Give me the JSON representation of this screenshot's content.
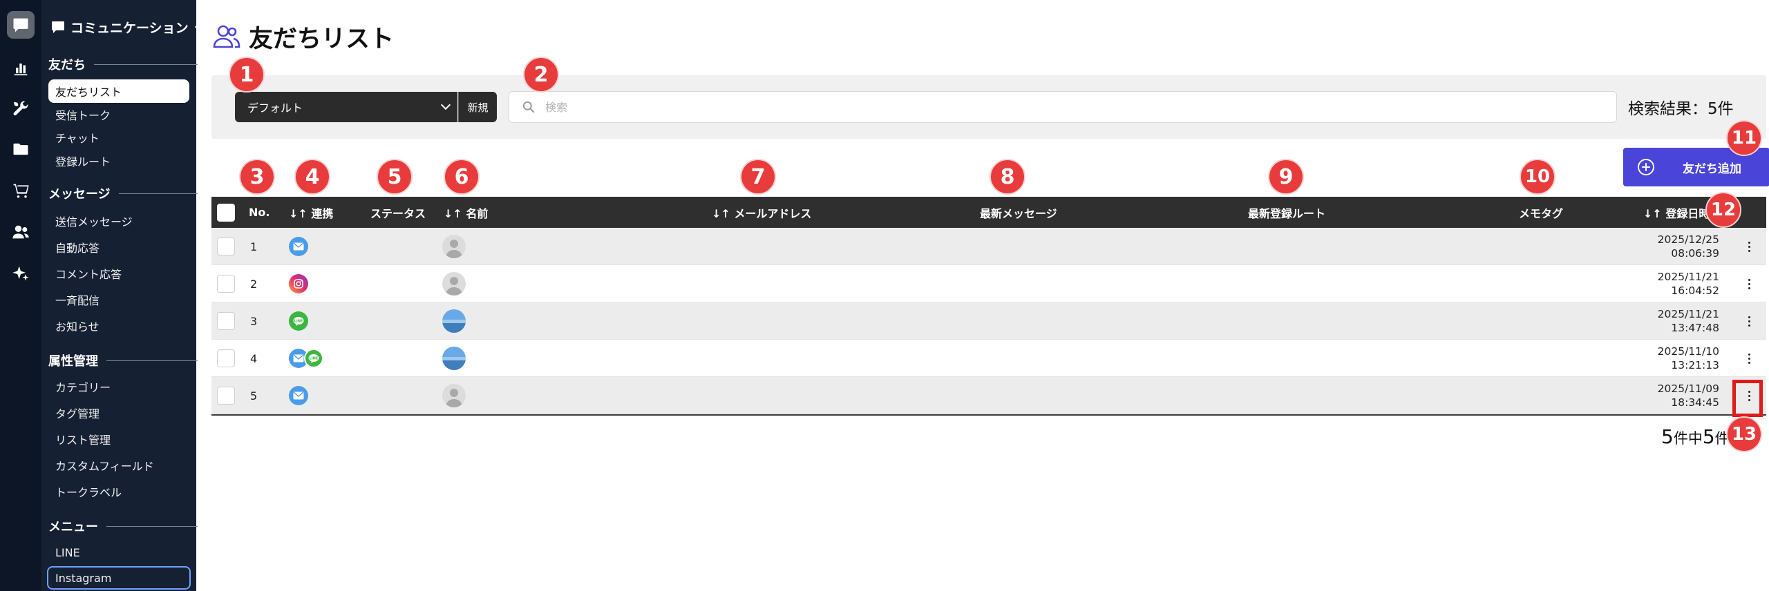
{
  "sidebar": {
    "header": "コミュニケーション",
    "sections": [
      {
        "title": "友だち",
        "items": [
          "友だちリスト",
          "受信トーク",
          "チャット",
          "登録ルート"
        ]
      },
      {
        "title": "メッセージ",
        "items": [
          "送信メッセージ",
          "自動応答",
          "コメント応答",
          "一斉配信",
          "お知らせ"
        ]
      },
      {
        "title": "属性管理",
        "items": [
          "カテゴリー",
          "タグ管理",
          "リスト管理",
          "カスタムフィールド",
          "トークラベル"
        ]
      },
      {
        "title": "メニュー",
        "items": [
          "LINE",
          "Instagram"
        ]
      }
    ],
    "active_item": "友だちリスト",
    "rail_icons": [
      "chat-icon",
      "analytics-icon",
      "tools-icon",
      "folder-icon",
      "cart-icon",
      "users-icon",
      "sparkle-icon"
    ]
  },
  "page": {
    "title": "友だちリスト"
  },
  "filter": {
    "preset_value": "デフォルト",
    "new_label": "新規",
    "search_placeholder": "検索",
    "result_count": "検索結果：5件"
  },
  "add_friend_label": "友だち追加",
  "table": {
    "columns": {
      "no": "No.",
      "channel": "↓↑ 連携",
      "status": "ステータス",
      "name": "↓↑ 名前",
      "email": "↓↑ メールアドレス",
      "latest_message": "最新メッセージ",
      "latest_route": "最新登録ルート",
      "memo_tag": "メモタグ",
      "registered": "↓↑ 登録日時"
    },
    "rows": [
      {
        "no": "1",
        "channels": [
          "mail"
        ],
        "avatar": "default",
        "date": "2025/12/25",
        "time": "08:06:39"
      },
      {
        "no": "2",
        "channels": [
          "instagram"
        ],
        "avatar": "default",
        "date": "2025/11/21",
        "time": "16:04:52"
      },
      {
        "no": "3",
        "channels": [
          "line"
        ],
        "avatar": "photo",
        "date": "2025/11/21",
        "time": "13:47:48"
      },
      {
        "no": "4",
        "channels": [
          "mail",
          "line"
        ],
        "avatar": "photo",
        "date": "2025/11/10",
        "time": "13:21:13"
      },
      {
        "no": "5",
        "channels": [
          "mail"
        ],
        "avatar": "default",
        "date": "2025/11/09",
        "time": "18:34:45"
      }
    ]
  },
  "pagination": {
    "total": "5",
    "unit_a": "件中",
    "shown": "5",
    "unit_b": "件"
  },
  "annotations": [
    "1",
    "2",
    "3",
    "4",
    "5",
    "6",
    "7",
    "8",
    "9",
    "10",
    "11",
    "12",
    "13"
  ],
  "colors": {
    "accent": "#4a44d8",
    "marker": "#e83b3b",
    "header_bg": "#2f2f2f",
    "sidebar_bg": "#162033"
  }
}
